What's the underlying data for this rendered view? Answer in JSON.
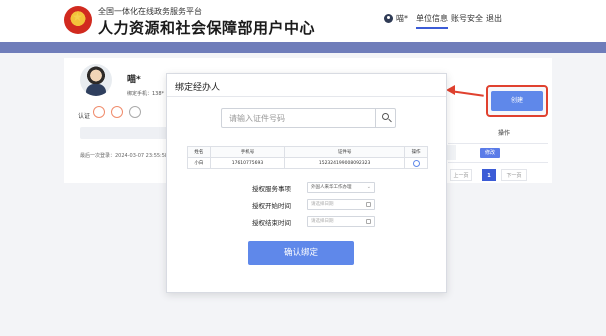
{
  "header": {
    "site_subtitle": "全国一体化在线政务服务平台",
    "site_title": "人力资源和社会保障部用户中心",
    "user_name": "喵*",
    "nav": [
      "单位信息",
      "账号安全",
      "退出"
    ],
    "active_nav": "单位信息"
  },
  "profile": {
    "name": "喵*",
    "phone_label": "绑定手机：138*",
    "auth_label": "认证",
    "last_login": "最后一次登录：2024-03-07 23:55:58"
  },
  "background_table": {
    "col_headers": [
      "定",
      "操作"
    ],
    "edit_button": "修改",
    "pagination": {
      "prev": "上一页",
      "current": "1",
      "next": "下一页"
    }
  },
  "create_button": "创建",
  "modal": {
    "title": "绑定经办人",
    "search_placeholder": "请输入证件号码",
    "table": {
      "headers": [
        "姓名",
        "手机号",
        "证件号",
        "操作"
      ],
      "rows": [
        {
          "name": "小白",
          "phone": "17610775693",
          "id_number": "152324199008092323"
        }
      ]
    },
    "form": {
      "service_label": "授权服务事项",
      "service_value": "外国人来华工作办理",
      "start_label": "授权开始时间",
      "start_placeholder": "请选择日期",
      "end_label": "授权结束时间",
      "end_placeholder": "请选择日期"
    },
    "confirm_button": "确认绑定"
  },
  "colors": {
    "primary": "#5f88ea",
    "band": "#6f7dba",
    "highlight": "#e0412f"
  }
}
